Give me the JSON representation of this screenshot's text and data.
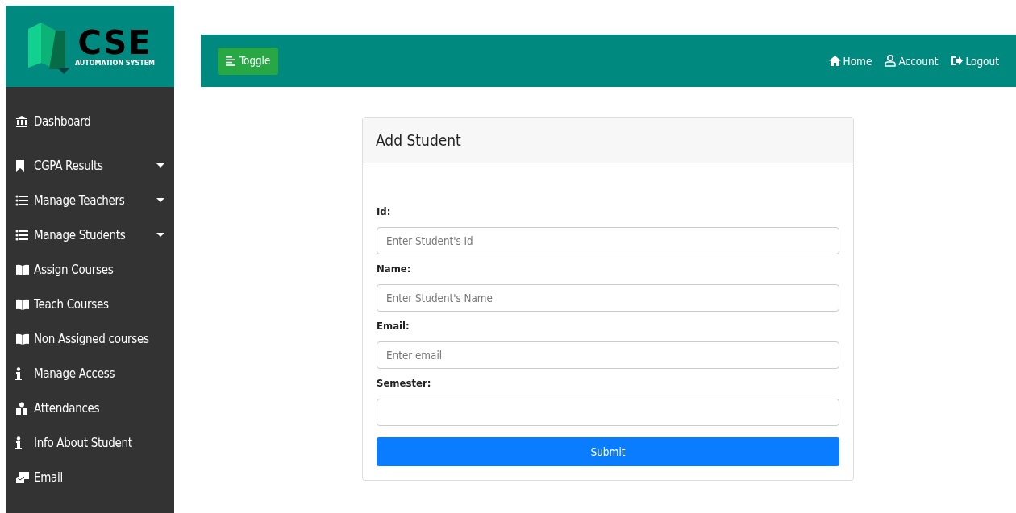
{
  "logo": {
    "title": "CSE",
    "subtitle": "AUTOMATION SYSTEM"
  },
  "sidebar": {
    "items": [
      {
        "label": "Dashboard",
        "has_submenu": false
      },
      {
        "label": "CGPA Results",
        "has_submenu": true
      },
      {
        "label": "Manage Teachers",
        "has_submenu": true
      },
      {
        "label": "Manage Students",
        "has_submenu": true
      },
      {
        "label": "Assign Courses",
        "has_submenu": false
      },
      {
        "label": "Teach Courses",
        "has_submenu": false
      },
      {
        "label": "Non Assigned courses",
        "has_submenu": false
      },
      {
        "label": "Manage Access",
        "has_submenu": false
      },
      {
        "label": "Attendances",
        "has_submenu": false
      },
      {
        "label": "Info About Student",
        "has_submenu": false
      },
      {
        "label": "Email",
        "has_submenu": false
      }
    ]
  },
  "navbar": {
    "toggle": "Toggle",
    "links": [
      {
        "label": "Home"
      },
      {
        "label": "Account"
      },
      {
        "label": "Logout"
      }
    ]
  },
  "form": {
    "title": "Add Student",
    "fields": [
      {
        "label": "Id:",
        "placeholder": "Enter Student's Id"
      },
      {
        "label": "Name:",
        "placeholder": "Enter Student's Name"
      },
      {
        "label": "Email:",
        "placeholder": "Enter email"
      },
      {
        "label": "Semester:"
      }
    ],
    "submit": "Submit"
  }
}
